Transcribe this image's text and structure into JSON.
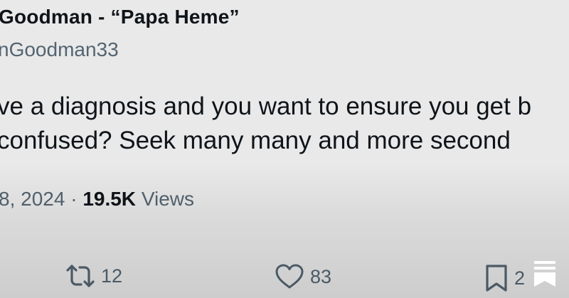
{
  "tweet": {
    "author_name": "Goodman - “Papa Heme”",
    "author_handle": "nGoodman33",
    "body_lines": [
      "ve a diagnosis and you want to ensure you get b",
      "confused?  Seek many many and more second"
    ],
    "date": "8, 2024",
    "separator": "·",
    "views_count": "19.5K",
    "views_label": "Views"
  },
  "actions": {
    "reposts": "12",
    "likes": "83",
    "bookmarks": "2"
  },
  "icons": {
    "repost": "repost-icon",
    "like": "heart-icon",
    "bookmark": "bookmark-icon",
    "overlay": "bookmark-stack-icon"
  },
  "colors": {
    "background": "#e9e9e9",
    "text": "#0f1419",
    "secondary": "#536471"
  }
}
